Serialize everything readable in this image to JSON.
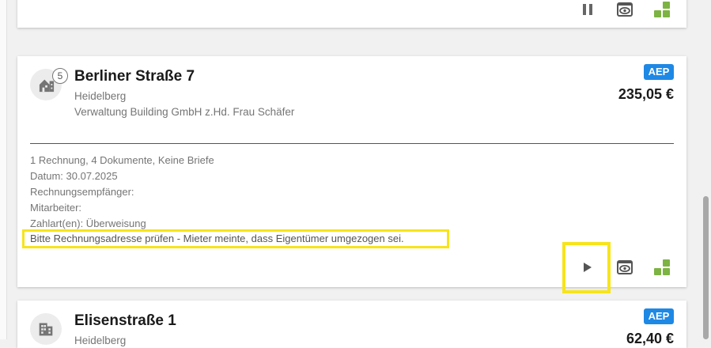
{
  "cards": [
    {
      "actions": [
        "pause-icon",
        "eye-window-icon",
        "grid-icon"
      ]
    },
    {
      "count": "5",
      "street": "Berliner Straße 7",
      "city": "Heidelberg",
      "manager": "Verwaltung Building GmbH z.Hd. Frau Schäfer",
      "tag": "AEP",
      "amount": "235,05 €",
      "info": [
        "1 Rechnung, 4 Dokumente, Keine Briefe",
        "Datum: 30.07.2025",
        "Rechnungsempfänger:",
        "Mitarbeiter:",
        "Zahlart(en): Überweisung"
      ],
      "note": "Bitte Rechnungsadresse prüfen - Mieter meinte, dass Eigentümer umgezogen sei.",
      "actions": [
        "play-icon",
        "eye-window-icon",
        "grid-icon"
      ]
    },
    {
      "street": "Elisenstraße 1",
      "city": "Heidelberg",
      "tag": "AEP",
      "amount": "62,40 €"
    }
  ],
  "colors": {
    "accent_blue": "#1e88e5",
    "green": "#7cb342",
    "highlight": "#f7e41a"
  }
}
